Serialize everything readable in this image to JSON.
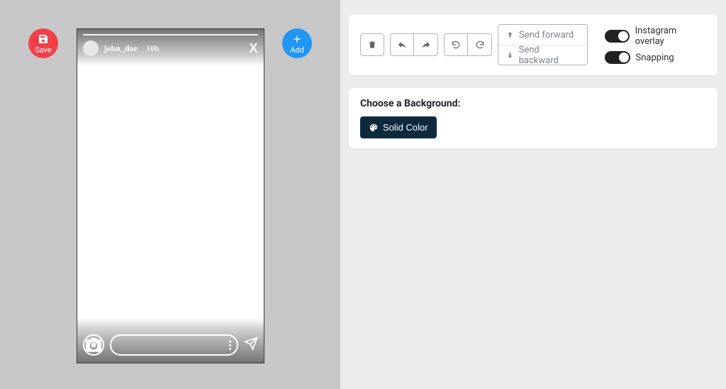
{
  "buttons": {
    "save": "Save",
    "add": "Add"
  },
  "story": {
    "username": "john_doe",
    "time": "10h",
    "close": "X"
  },
  "toolbar": {
    "send_forward": "Send forward",
    "send_backward": "Send backward"
  },
  "toggles": {
    "overlay": "Instagram overlay",
    "snapping": "Snapping"
  },
  "background": {
    "heading": "Choose a Background:",
    "solid": "Solid Color"
  }
}
